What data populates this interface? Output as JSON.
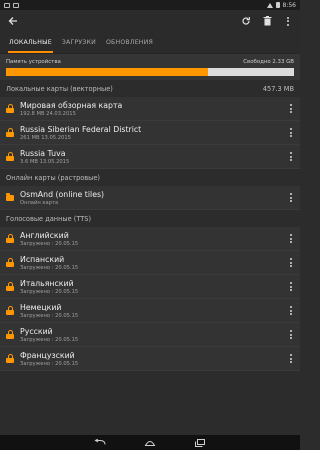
{
  "statusbar": {
    "time": "8:56"
  },
  "toolbar": {
    "back_icon": "arrow-back-icon",
    "actions": [
      "refresh-icon",
      "delete-icon",
      "overflow-menu-icon"
    ]
  },
  "tabs": [
    {
      "label": "ЛОКАЛЬНЫЕ",
      "active": true
    },
    {
      "label": "ЗАГРУЗКИ",
      "active": false
    },
    {
      "label": "ОБНОВЛЕНИЯ",
      "active": false
    }
  ],
  "memory": {
    "label": "Память устройства",
    "free": "Свободно 2.33 GB",
    "used_fraction": 0.7
  },
  "local_vector": {
    "header": "Локальные карты (векторные)",
    "size": "457.3 MB",
    "items": [
      {
        "title": "Мировая обзорная карта",
        "sub": "192.8 MB  24.03.2015"
      },
      {
        "title": "Russia Siberian Federal District",
        "sub": "261 MB  13.05.2015"
      },
      {
        "title": "Russia Tuva",
        "sub": "3.6 MB  13.05.2015"
      }
    ]
  },
  "online_raster": {
    "header": "Онлайн карты (растровые)",
    "items": [
      {
        "title": "OsmAnd (online tiles)",
        "sub": "Онлайн карта"
      }
    ]
  },
  "voice": {
    "header": "Голосовые данные (TTS)",
    "items": [
      {
        "title": "Английский",
        "sub": "Загружено : 20.05.15"
      },
      {
        "title": "Испанский",
        "sub": "Загружено : 20.05.15"
      },
      {
        "title": "Итальянский",
        "sub": "Загружено : 20.05.15"
      },
      {
        "title": "Немецкий",
        "sub": "Загружено : 20.05.15"
      },
      {
        "title": "Русский",
        "sub": "Загружено : 20.05.15"
      },
      {
        "title": "Французский",
        "sub": "Загружено : 20.05.15"
      }
    ]
  },
  "colors": {
    "accent": "#ff9800",
    "background": "#2c2c2c",
    "item_background": "#333333"
  }
}
